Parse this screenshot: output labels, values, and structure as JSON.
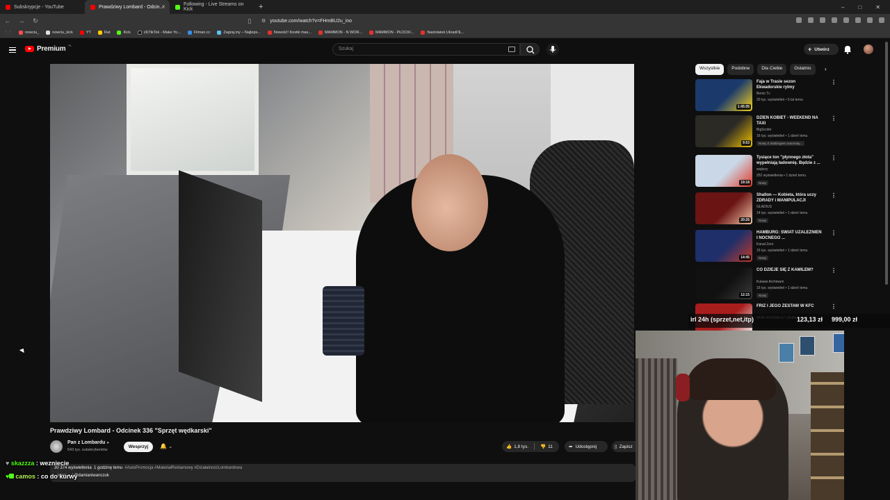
{
  "browser": {
    "tabs": [
      {
        "title": "Subskrypcje - YouTube",
        "favicon": "youtube-icon"
      },
      {
        "title": "Prawdziwy Lombard - Odcin...",
        "favicon": "youtube-icon"
      },
      {
        "title": "Following - Live Streams on Kick",
        "favicon": "kick-icon"
      }
    ],
    "url": "youtube.com/watch?v=FHmBU2u_ino",
    "bookmarks": [
      "nowciu_",
      "nowciu_kick",
      "YT",
      "Rat",
      "Kick",
      "(4)TikTok - Make Yo...",
      "Filman.cc",
      "Zagraj.my – Najleps...",
      "Nowość! Kostki mas...",
      "MAMMON - N WOR...",
      "MAMMON - PŁOCKI...",
      "Nastolatek Ukradł $..."
    ]
  },
  "youtube": {
    "logo_text": "Premium",
    "logo_region": "PL",
    "search_placeholder": "Szukaj",
    "create_label": "Utwórz"
  },
  "video": {
    "title": "Prawdziwy Lombard - Odcinek 336 \"Sprzęt wędkarski\"",
    "channel": "Pan z Lombardu",
    "subscribers": "543 tys. subskrybentów",
    "support_label": "Wesprzyj",
    "likes": "1,8 tys.",
    "dislikes": "11",
    "share_label": "Udostępnij",
    "save_label": "Zapisz",
    "views": "30 374 wyświetlenia",
    "posted": "1 godzinę temu",
    "hashtags": "#AutoPromocja #MateriałReklamowy #DziałalnośćLombardowa",
    "desc_line2": "...iana: ● / @damianiwanczuk"
  },
  "chat": [
    {
      "user": "skazzza",
      "message": "wezniecie"
    },
    {
      "user": "camos",
      "message": "co do kurwy"
    }
  ],
  "chips": [
    "Wszystkie",
    "Podobne",
    "Dla Ciebie",
    "Ostatnio"
  ],
  "recommendations": [
    {
      "title": "Faja w Trasie sezon Ekwadorskie rytmy",
      "channel": "Benio Tv",
      "meta": "20 tys. wyświetleń • 5 lat temu",
      "duration": "1:45:05",
      "badge": "",
      "color1": "#1b3a6b",
      "color2": "#f7d21c"
    },
    {
      "title": "DZIEŃ KOBIET - WEEKEND NA TAXI",
      "channel": "BigScofer",
      "meta": "16 tys. wyświetleń • 1 dzień temu",
      "duration": "9:53",
      "badge": "Nowy  Z dubbingiem automaty...",
      "color1": "#2c2a25",
      "color2": "#f2c200"
    },
    {
      "title": "Tysiące ton \"płynnego złota\" wypełniają ładownię. Będzie z ...",
      "channel": "wojtzzy",
      "meta": "252 wyświetlenia • 1 dzień temu",
      "duration": "19:18",
      "badge": "Nowy",
      "color1": "#c9d7e6",
      "color2": "#e23b2a"
    },
    {
      "title": "Shallon — Kobieta, która uczy ZDRADY i MANIPULACJI",
      "channel": "GLADIUS",
      "meta": "14 tys. wyświetleń • 1 dzień temu",
      "duration": "20:26",
      "badge": "Nowy",
      "color1": "#6a1414",
      "color2": "#f2c6a6"
    },
    {
      "title": "HAMBURG: ŚWIAT UZALEŻNIEŃ I NOCNEGO ...",
      "channel": "Kanał Zero",
      "meta": "15 tys. wyświetleń • 1 dzień temu",
      "duration": "14:45",
      "badge": "Nowy",
      "color1": "#1e2f6a",
      "color2": "#c23a2a"
    },
    {
      "title": "CO DZIEJE SIĘ Z KAMILEM?",
      "channel": "Kulawe Archiwum",
      "meta": "16 tys. wyświetleń • 1 dzień temu",
      "duration": "12:15",
      "badge": "Nowy",
      "color1": "#111111",
      "color2": "#3a3a3a"
    },
    {
      "title": "FRIZ I JEGO ZESTAW W KFC",
      "channel": "MNIE ROZWALIŁ!! (Mafia)",
      "meta": "",
      "duration": "",
      "badge": "",
      "color1": "#a81d1d",
      "color2": "#f4f4f4"
    }
  ],
  "overlay": {
    "text": "irl 24h (sprzet,net,itp)",
    "amount1": "123,13 zł",
    "amount2": "999,00 zł"
  }
}
